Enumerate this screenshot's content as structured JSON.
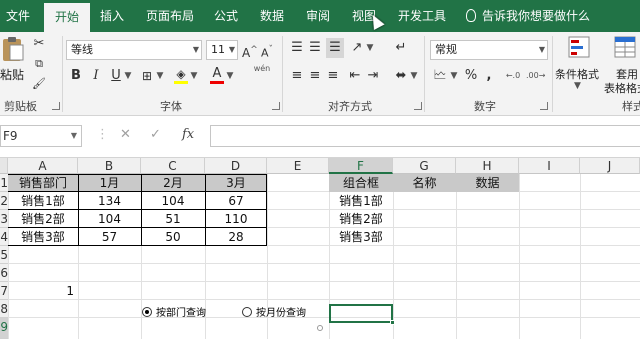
{
  "ribbon_tabs": [
    "文件",
    "开始",
    "插入",
    "页面布局",
    "公式",
    "数据",
    "审阅",
    "视图",
    "开发工具"
  ],
  "tell_me": "告诉我你想要做什么",
  "clipboard": {
    "paste_label": "粘贴",
    "group_label": "剪贴板"
  },
  "font": {
    "name": "等线",
    "size": "11",
    "group_label": "字体",
    "bold": "B",
    "italic": "I",
    "underline": "U",
    "font_color_glyph": "A",
    "wen": "wén"
  },
  "alignment": {
    "group_label": "对齐方式"
  },
  "number": {
    "format": "常规",
    "group_label": "数字",
    "percent": "%",
    "comma": ","
  },
  "styles": {
    "conditional_format": "条件格式",
    "table_format_line1": "套用",
    "table_format_line2": "表格格式",
    "group_label": "样式"
  },
  "formula_bar": {
    "name_box": "F9",
    "fx": "fx",
    "cancel": "✕",
    "enter": "✓",
    "value": ""
  },
  "columns": [
    "A",
    "B",
    "C",
    "D",
    "E",
    "F",
    "G",
    "H",
    "I",
    "J"
  ],
  "selected_column": "F",
  "rows": [
    "1",
    "2",
    "3",
    "4",
    "5",
    "6",
    "7",
    "8",
    "9"
  ],
  "selected_row": "9",
  "table": {
    "headers": [
      "销售部门",
      "1月",
      "2月",
      "3月"
    ],
    "rows": [
      [
        "销售1部",
        "134",
        "104",
        "67"
      ],
      [
        "销售2部",
        "104",
        "51",
        "110"
      ],
      [
        "销售3部",
        "57",
        "50",
        "28"
      ]
    ]
  },
  "combo_list": {
    "header": "组合框",
    "items": [
      "销售1部",
      "销售2部",
      "销售3部"
    ]
  },
  "lookup_headers": [
    "名称",
    "数据"
  ],
  "cell_a7": "1",
  "radio_options": [
    {
      "label": "按部门查询",
      "checked": true
    },
    {
      "label": "按月份查询",
      "checked": false
    }
  ],
  "colors": {
    "accent": "#217346",
    "header_fill": "#c9c9c9"
  }
}
